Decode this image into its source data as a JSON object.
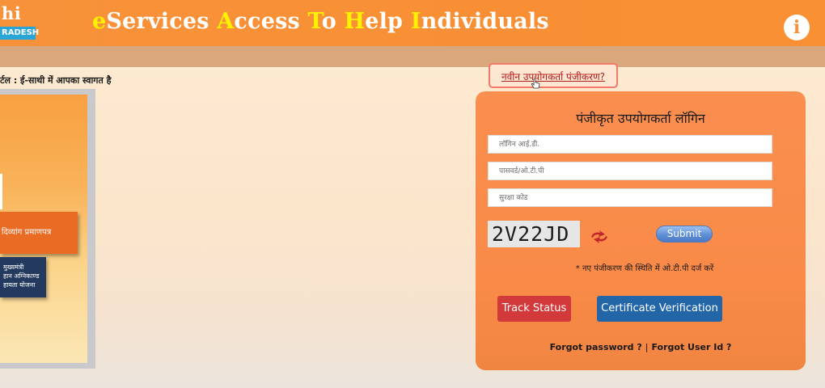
{
  "header": {
    "logo_text": "hi",
    "logo_badge": "RADESH",
    "title_parts": [
      {
        "text": "e",
        "highlight": true
      },
      {
        "text": "Services ",
        "highlight": false
      },
      {
        "text": "A",
        "highlight": true
      },
      {
        "text": "ccess ",
        "highlight": false
      },
      {
        "text": "T",
        "highlight": true
      },
      {
        "text": "o ",
        "highlight": false
      },
      {
        "text": "H",
        "highlight": true
      },
      {
        "text": "elp ",
        "highlight": false
      },
      {
        "text": "I",
        "highlight": true
      },
      {
        "text": "ndividuals",
        "highlight": false
      }
    ],
    "info_label": "i"
  },
  "welcome_text": "र्टल : ई-साथी में आपका स्वागत है",
  "banner": {
    "tile_1": "दिव्यांग प्रमाणपत्र",
    "tile_2_lines": [
      "मुख्यमंत्री",
      "हान अग्निकाण्ड",
      "हायता योजना"
    ]
  },
  "registration_link": "नवीन उपयोगकर्ता पंजीकरण?",
  "login": {
    "title": "पंजीकृत उपयोगकर्ता लॉगिन",
    "user_id_placeholder": "लॉगिन आई.डी.",
    "password_placeholder": "पासवर्ड/ओ.टी.पी",
    "security_code_placeholder": "सुरक्षा कोड",
    "captcha_text": "2V22JD",
    "submit_label": "Submit",
    "otp_note": "* नए पंजीकरण की स्थिति में ओ.टी.पी दर्ज करें",
    "track_status_label": "Track Status",
    "certificate_verification_label": "Certificate Verification",
    "forgot_password_label": "Forgot password ?",
    "separator": "|",
    "forgot_user_id_label": "Forgot User Id ?"
  },
  "colors": {
    "header": "#f7923a",
    "title_highlight": "#fff200",
    "panel": "#fb8f4f",
    "track_button": "#d2393a",
    "cert_button": "#2366a8"
  }
}
